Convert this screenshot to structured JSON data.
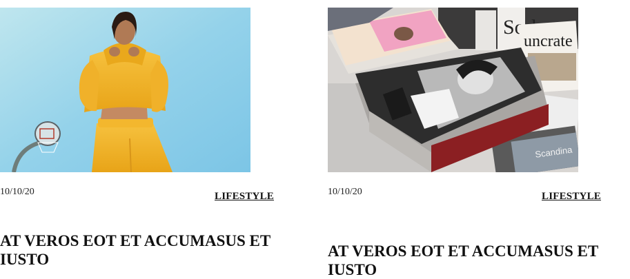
{
  "posts": [
    {
      "image": "photo of woman in yellow hoodie and sweatpants beside basketball hoop",
      "date": "10/10/20",
      "category": "LIFESTYLE",
      "title": "AT VEROS EOT ET ACCUMASUS ET IUSTO"
    },
    {
      "image": "photo of stacked magazines on a newsstand",
      "date": "10/10/20",
      "category": "LIFESTYLE",
      "title": "AT VEROS EOT ET ACCUMASUS ET IUSTO"
    }
  ],
  "colors": {
    "sky": "#9fd4ec",
    "yellow": "#f0b429",
    "text": "#111111"
  },
  "magazine_covers": {
    "sorbet": "Sorbet",
    "uncrate": "uncrate",
    "scandinavian": "Scandina"
  }
}
